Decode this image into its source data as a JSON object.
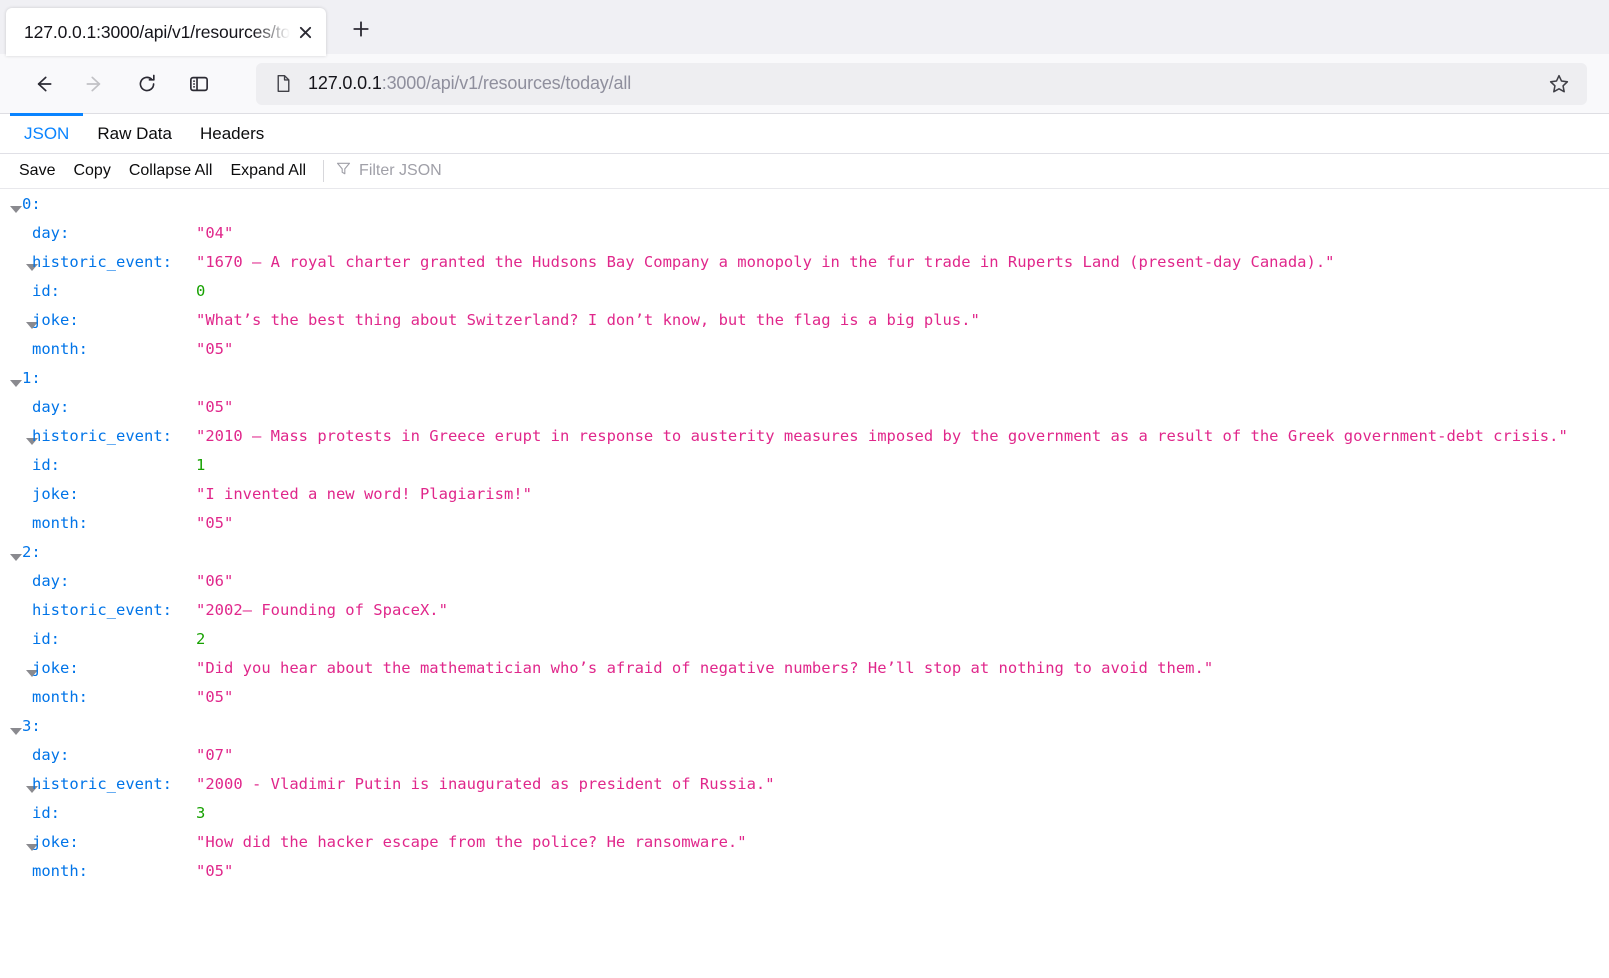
{
  "browser": {
    "tab": {
      "title": "127.0.0.1:3000/api/v1/resources/tod",
      "close_icon": "close-icon"
    },
    "new_tab_label": "+",
    "nav": {
      "back_icon": "back-arrow-icon",
      "forward_icon": "forward-arrow-icon",
      "reload_icon": "reload-icon",
      "sidebar_icon": "sidebar-panel-icon",
      "page_icon": "document-page-icon",
      "star_icon": "bookmark-star-icon"
    },
    "url": {
      "host": "127.0.0.1",
      "rest": ":3000/api/v1/resources/today/all",
      "full": "127.0.0.1:3000/api/v1/resources/today/all"
    }
  },
  "viewer": {
    "tabs": [
      {
        "label": "JSON",
        "active": true
      },
      {
        "label": "Raw Data",
        "active": false
      },
      {
        "label": "Headers",
        "active": false
      }
    ],
    "actions": [
      {
        "label": "Save"
      },
      {
        "label": "Copy"
      },
      {
        "label": "Collapse All"
      },
      {
        "label": "Expand All"
      }
    ],
    "filter": {
      "icon": "filter-funnel-icon",
      "placeholder": "Filter JSON",
      "value": ""
    }
  },
  "json": {
    "entries": [
      {
        "index": "0",
        "index_twisty": true,
        "fields": [
          {
            "key": "day",
            "value": "\"04\"",
            "type": "string",
            "twisty": false
          },
          {
            "key": "historic_event",
            "value": "\"1670 – A royal charter granted the Hudsons Bay Company a monopoly in the fur trade in Ruperts Land (present-day Canada).\"",
            "type": "string",
            "twisty": true
          },
          {
            "key": "id",
            "value": "0",
            "type": "number",
            "twisty": false
          },
          {
            "key": "joke",
            "value": "\"What’s the best thing about Switzerland? I don’t know, but the flag is a big plus.\"",
            "type": "string",
            "twisty": true
          },
          {
            "key": "month",
            "value": "\"05\"",
            "type": "string",
            "twisty": false
          }
        ]
      },
      {
        "index": "1",
        "index_twisty": true,
        "fields": [
          {
            "key": "day",
            "value": "\"05\"",
            "type": "string",
            "twisty": false
          },
          {
            "key": "historic_event",
            "value": "\"2010 – Mass protests in Greece erupt in response to austerity measures imposed by the government as a result of the Greek government-debt crisis.\"",
            "type": "string",
            "twisty": true
          },
          {
            "key": "id",
            "value": "1",
            "type": "number",
            "twisty": false
          },
          {
            "key": "joke",
            "value": "\"I invented a new word! Plagiarism!\"",
            "type": "string",
            "twisty": false
          },
          {
            "key": "month",
            "value": "\"05\"",
            "type": "string",
            "twisty": false
          }
        ]
      },
      {
        "index": "2",
        "index_twisty": true,
        "fields": [
          {
            "key": "day",
            "value": "\"06\"",
            "type": "string",
            "twisty": false
          },
          {
            "key": "historic_event",
            "value": "\"2002– Founding of SpaceX.\"",
            "type": "string",
            "twisty": false
          },
          {
            "key": "id",
            "value": "2",
            "type": "number",
            "twisty": false
          },
          {
            "key": "joke",
            "value": "\"Did you hear about the mathematician who’s afraid of negative numbers? He’ll stop at nothing to avoid them.\"",
            "type": "string",
            "twisty": true
          },
          {
            "key": "month",
            "value": "\"05\"",
            "type": "string",
            "twisty": false
          }
        ]
      },
      {
        "index": "3",
        "index_twisty": true,
        "fields": [
          {
            "key": "day",
            "value": "\"07\"",
            "type": "string",
            "twisty": false
          },
          {
            "key": "historic_event",
            "value": "\"2000 - Vladimir Putin is inaugurated as president of Russia.\"",
            "type": "string",
            "twisty": true
          },
          {
            "key": "id",
            "value": "3",
            "type": "number",
            "twisty": false
          },
          {
            "key": "joke",
            "value": "\"How did the hacker escape from the police? He ransomware.\"",
            "type": "string",
            "twisty": true
          },
          {
            "key": "month",
            "value": "\"05\"",
            "type": "string",
            "twisty": false
          }
        ]
      }
    ]
  },
  "colors": {
    "key_blue": "#0074e8",
    "string_pink": "#e0278b",
    "number_green": "#16a100",
    "accent_tab": "#0a84ff"
  }
}
